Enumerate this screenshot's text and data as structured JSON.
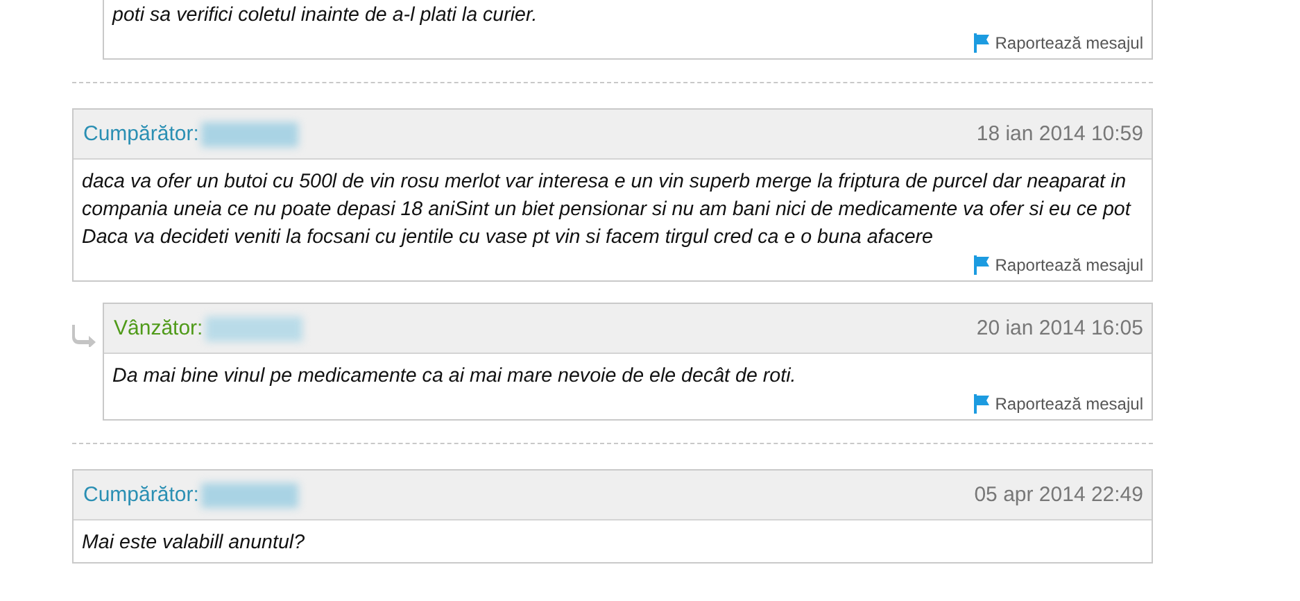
{
  "messages": [
    {
      "kind": "seller",
      "reply": true,
      "text": "poti sa verifici coletul inainte de a-l plati la curier.",
      "report": "Raportează mesajul"
    },
    {
      "kind": "buyer",
      "reply": false,
      "author_label": "Cumpărător:",
      "date": "18 ian 2014 10:59",
      "text": "daca va ofer un butoi cu 500l de vin rosu merlot var interesa e un vin superb merge la friptura de purcel dar neaparat in compania uneia ce nu poate depasi 18 aniSint un biet pensionar si nu am bani nici de medicamente va ofer si eu ce pot Daca va decideti veniti la focsani cu jentile cu vase pt vin si facem tirgul cred ca e o buna afacere",
      "report": "Raportează mesajul"
    },
    {
      "kind": "seller",
      "reply": true,
      "author_label": "Vânzător:",
      "date": "20 ian 2014 16:05",
      "text": "Da mai bine vinul pe medicamente ca ai mai mare nevoie de ele decât de roti.",
      "report": "Raportează mesajul"
    },
    {
      "kind": "buyer",
      "reply": false,
      "author_label": "Cumpărător:",
      "date": "05 apr 2014 22:49",
      "text": "Mai este valabill anuntul?"
    }
  ]
}
